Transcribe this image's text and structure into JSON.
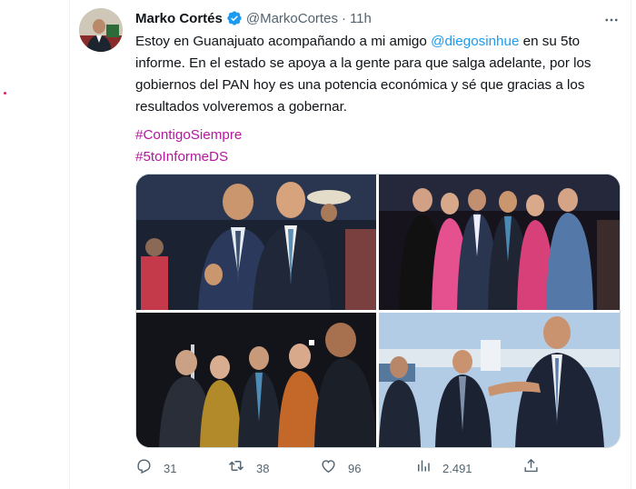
{
  "tweet": {
    "author_name": "Marko Cortés",
    "handle": "@MarkoCortes",
    "separator": "·",
    "time": "11h",
    "text_before_mention": "Estoy en Guanajuato acompañando a mi amigo ",
    "mention": "@diegosinhue",
    "text_after_mention": " en su 5to informe. En el estado se apoya a la gente para que salga adelante, por los gobiernos del PAN hoy es una potencia económica y sé que gracias a los resultados volveremos a gobernar.",
    "hashtags": [
      "#ContigoSiempre",
      "#5toInformeDS"
    ]
  },
  "actions": {
    "replies": "31",
    "retweets": "38",
    "likes": "96",
    "views": "2.491"
  },
  "colors": {
    "mention": "#1d9bf0",
    "hashtag": "#b5179e",
    "verified": "#1d9bf0",
    "muted": "#536471"
  },
  "icons": {
    "verified": "verified-badge-icon",
    "more": "more-horizontal-icon",
    "reply": "reply-icon",
    "retweet": "retweet-icon",
    "like": "heart-icon",
    "views": "views-chart-icon",
    "share": "share-icon"
  }
}
